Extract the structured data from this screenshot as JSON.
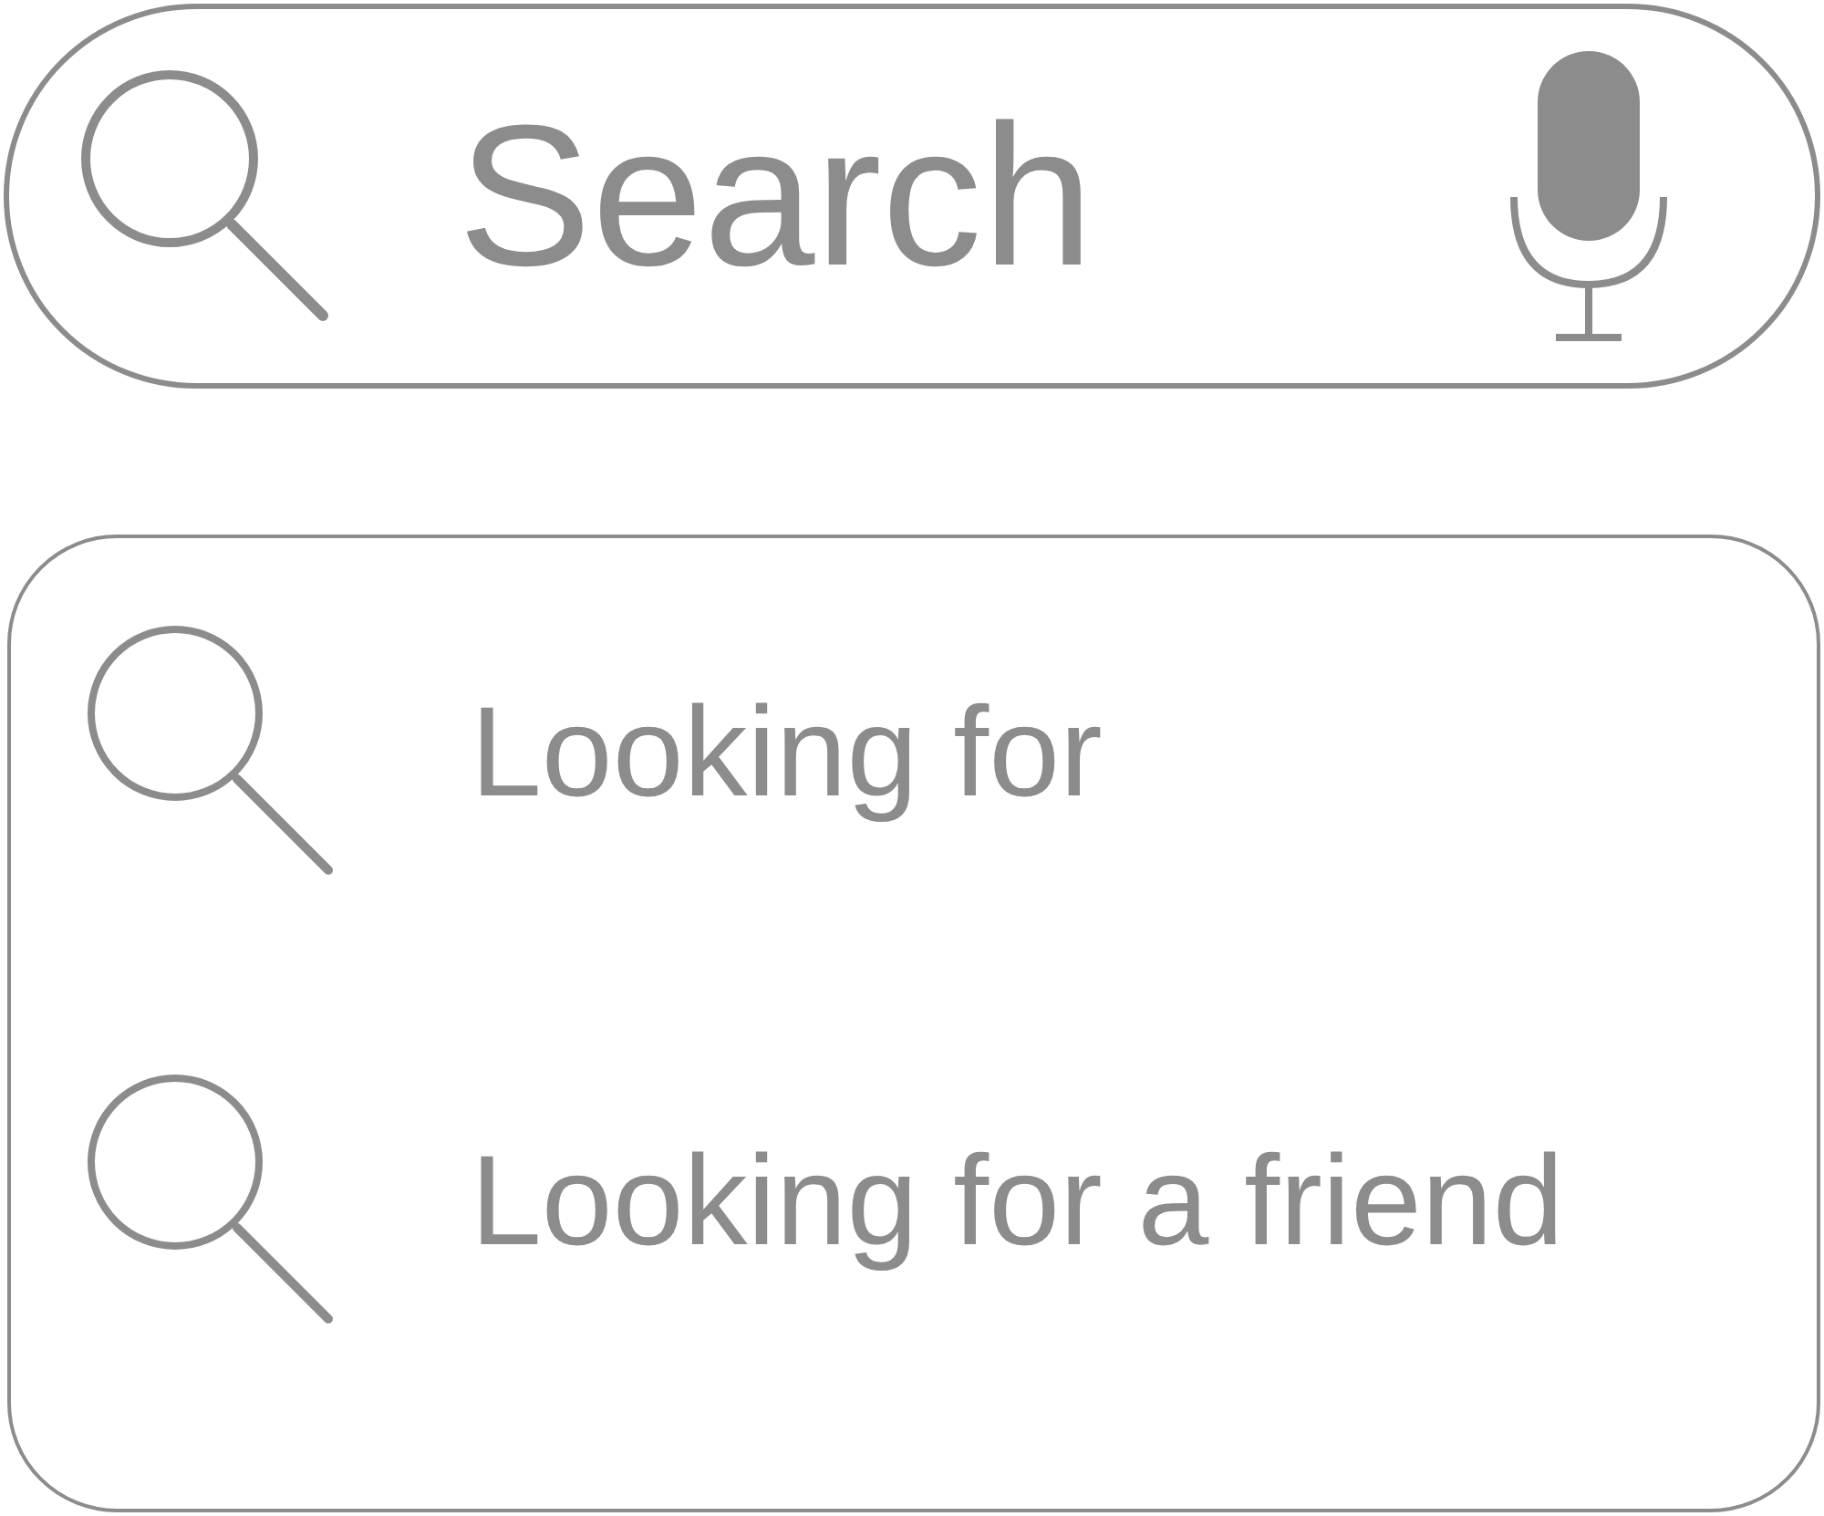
{
  "search_bar": {
    "placeholder": "Search"
  },
  "suggestions": [
    {
      "text": "Looking for"
    },
    {
      "text": "Looking for a friend"
    }
  ]
}
